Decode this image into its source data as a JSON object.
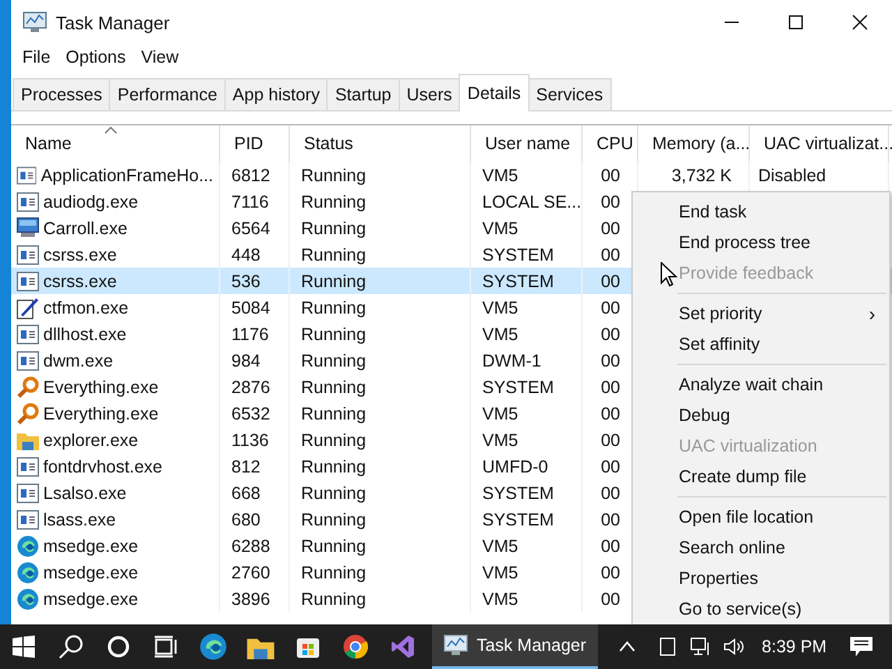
{
  "window": {
    "title": "Task Manager"
  },
  "menu_bar": [
    "File",
    "Options",
    "View"
  ],
  "tabs": [
    {
      "label": "Processes",
      "selected": false
    },
    {
      "label": "Performance",
      "selected": false
    },
    {
      "label": "App history",
      "selected": false
    },
    {
      "label": "Startup",
      "selected": false
    },
    {
      "label": "Users",
      "selected": false
    },
    {
      "label": "Details",
      "selected": true
    },
    {
      "label": "Services",
      "selected": false
    }
  ],
  "table": {
    "columns": [
      "Name",
      "PID",
      "Status",
      "User name",
      "CPU",
      "Memory (a...",
      "UAC virtualizat..."
    ],
    "rows": [
      {
        "kind": "app",
        "name": "ApplicationFrameHo...",
        "pid": "6812",
        "status": "Running",
        "user": "VM5",
        "cpu": "00",
        "memory": "3,732 K",
        "uac": "Disabled",
        "selected": false
      },
      {
        "kind": "app",
        "name": "audiodg.exe",
        "pid": "7116",
        "status": "Running",
        "user": "LOCAL SE...",
        "cpu": "00",
        "selected": false
      },
      {
        "kind": "monitor",
        "name": "Carroll.exe",
        "pid": "6564",
        "status": "Running",
        "user": "VM5",
        "cpu": "00",
        "selected": false
      },
      {
        "kind": "app",
        "name": "csrss.exe",
        "pid": "448",
        "status": "Running",
        "user": "SYSTEM",
        "cpu": "00",
        "selected": false
      },
      {
        "kind": "app",
        "name": "csrss.exe",
        "pid": "536",
        "status": "Running",
        "user": "SYSTEM",
        "cpu": "00",
        "selected": true
      },
      {
        "kind": "pen",
        "name": "ctfmon.exe",
        "pid": "5084",
        "status": "Running",
        "user": "VM5",
        "cpu": "00",
        "selected": false
      },
      {
        "kind": "app",
        "name": "dllhost.exe",
        "pid": "1176",
        "status": "Running",
        "user": "VM5",
        "cpu": "00",
        "selected": false
      },
      {
        "kind": "app",
        "name": "dwm.exe",
        "pid": "984",
        "status": "Running",
        "user": "DWM-1",
        "cpu": "00",
        "selected": false
      },
      {
        "kind": "magnifier",
        "name": "Everything.exe",
        "pid": "2876",
        "status": "Running",
        "user": "SYSTEM",
        "cpu": "00",
        "selected": false
      },
      {
        "kind": "magnifier",
        "name": "Everything.exe",
        "pid": "6532",
        "status": "Running",
        "user": "VM5",
        "cpu": "00",
        "selected": false
      },
      {
        "kind": "folder",
        "name": "explorer.exe",
        "pid": "1136",
        "status": "Running",
        "user": "VM5",
        "cpu": "00",
        "selected": false
      },
      {
        "kind": "app",
        "name": "fontdrvhost.exe",
        "pid": "812",
        "status": "Running",
        "user": "UMFD-0",
        "cpu": "00",
        "selected": false
      },
      {
        "kind": "app",
        "name": "Lsalso.exe",
        "pid": "668",
        "status": "Running",
        "user": "SYSTEM",
        "cpu": "00",
        "selected": false
      },
      {
        "kind": "app",
        "name": "lsass.exe",
        "pid": "680",
        "status": "Running",
        "user": "SYSTEM",
        "cpu": "00",
        "selected": false
      },
      {
        "kind": "edge",
        "name": "msedge.exe",
        "pid": "6288",
        "status": "Running",
        "user": "VM5",
        "cpu": "00",
        "selected": false
      },
      {
        "kind": "edge",
        "name": "msedge.exe",
        "pid": "2760",
        "status": "Running",
        "user": "VM5",
        "cpu": "00",
        "selected": false
      },
      {
        "kind": "edge",
        "name": "msedge.exe",
        "pid": "3896",
        "status": "Running",
        "user": "VM5",
        "cpu": "00",
        "selected": false
      }
    ]
  },
  "context_menu": [
    {
      "kind": "item",
      "label": "End task",
      "disabled": false
    },
    {
      "kind": "item",
      "label": "End process tree",
      "disabled": false
    },
    {
      "kind": "item",
      "label": "Provide feedback",
      "disabled": true
    },
    {
      "kind": "separator"
    },
    {
      "kind": "submenu",
      "label": "Set priority",
      "arrow": "›",
      "disabled": false
    },
    {
      "kind": "item",
      "label": "Set affinity",
      "disabled": false
    },
    {
      "kind": "separator"
    },
    {
      "kind": "item",
      "label": "Analyze wait chain",
      "disabled": false
    },
    {
      "kind": "item",
      "label": "Debug",
      "disabled": false
    },
    {
      "kind": "item",
      "label": "UAC virtualization",
      "disabled": true
    },
    {
      "kind": "item",
      "label": "Create dump file",
      "disabled": false
    },
    {
      "kind": "separator"
    },
    {
      "kind": "item",
      "label": "Open file location",
      "disabled": false
    },
    {
      "kind": "item",
      "label": "Search online",
      "disabled": false
    },
    {
      "kind": "item",
      "label": "Properties",
      "disabled": false
    },
    {
      "kind": "item",
      "label": "Go to service(s)",
      "disabled": false
    }
  ],
  "taskbar": {
    "active_window": "Task Manager",
    "clock": "8:39 PM"
  }
}
